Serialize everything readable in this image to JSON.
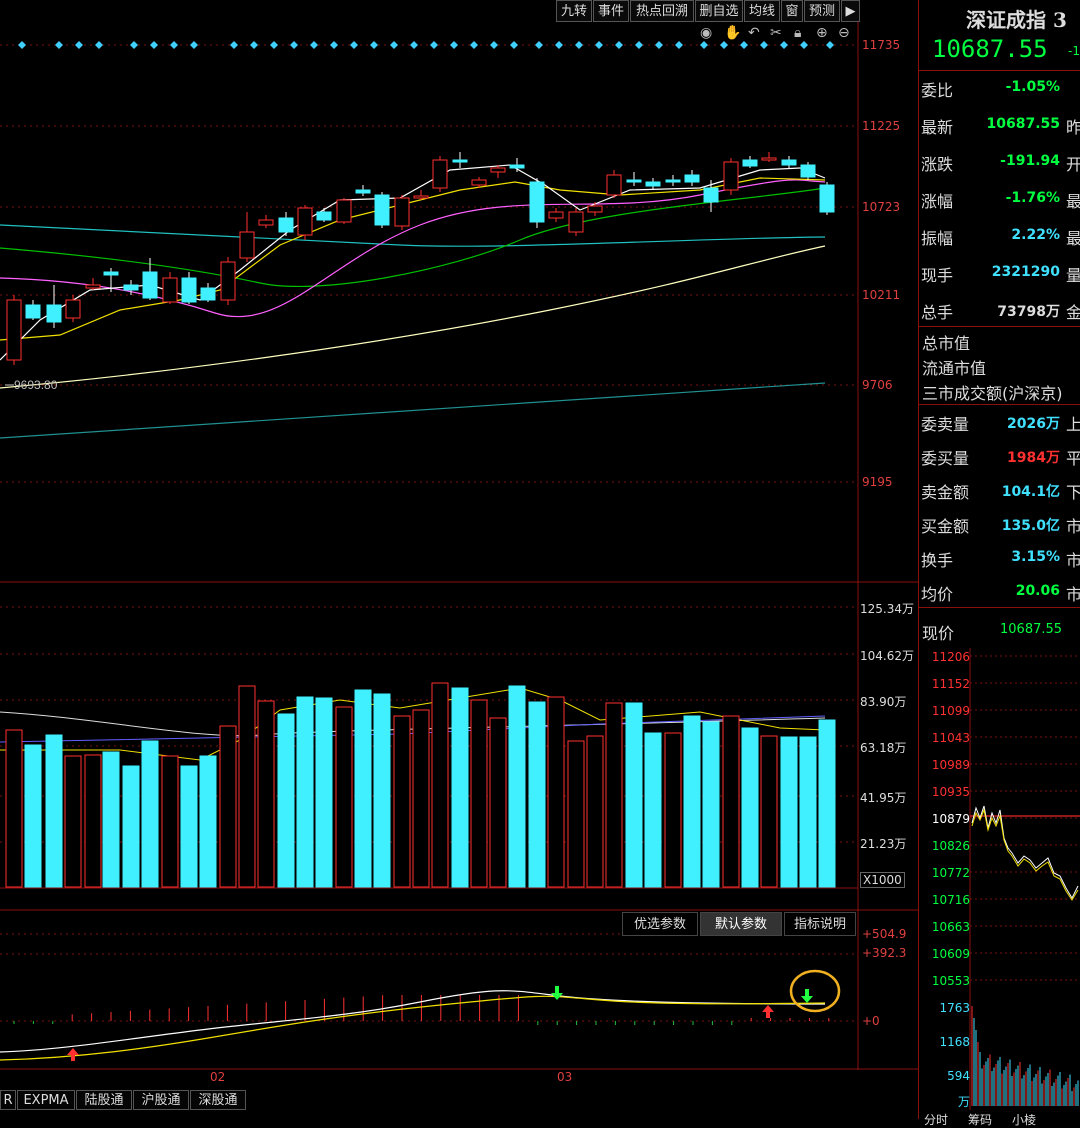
{
  "toolbar": {
    "buttons": [
      "九转",
      "事件",
      "热点回溯",
      "删自选",
      "均线",
      "窗",
      "预测"
    ],
    "icons": [
      "eye-icon",
      "hand-icon",
      "undo-icon",
      "scissors-icon",
      "lock-icon",
      "zoom-in-icon",
      "zoom-out-icon"
    ]
  },
  "main_chart": {
    "price_ticks": [
      "11735",
      "11225",
      "10723",
      "10211",
      "9706",
      "9195"
    ],
    "low_marker": "9693.80"
  },
  "volume_chart": {
    "ticks": [
      "125.34万",
      "104.62万",
      "83.90万",
      "63.18万",
      "41.95万",
      "21.23万"
    ],
    "multiplier": "X1000"
  },
  "indicator_panel": {
    "buttons": [
      "优选参数",
      "默认参数",
      "指标说明"
    ],
    "ticks": [
      "+504.9",
      "+392.3",
      "+0"
    ],
    "x_labels": [
      "02",
      "03"
    ]
  },
  "bottom_tabs": [
    "R",
    "EXPMA",
    "陆股通",
    "沪股通",
    "深股通"
  ],
  "quote": {
    "title": "深证成指 3",
    "price": "10687.55",
    "change_hint": "-1",
    "rows": [
      {
        "key": "委比",
        "value": "-1.05%",
        "color": "#00ff40",
        "suffix": ""
      },
      {
        "key": "最新",
        "value": "10687.55",
        "color": "#00ff40",
        "suffix": "昨"
      },
      {
        "key": "涨跌",
        "value": "-191.94",
        "color": "#00ff40",
        "suffix": "开"
      },
      {
        "key": "涨幅",
        "value": "-1.76%",
        "color": "#00ff40",
        "suffix": "最"
      },
      {
        "key": "振幅",
        "value": "2.22%",
        "color": "#40e0ff",
        "suffix": "最"
      },
      {
        "key": "现手",
        "value": "2321290",
        "color": "#40e0ff",
        "suffix": "量"
      },
      {
        "key": "总手",
        "value": "73798万",
        "color": "#dddddd",
        "suffix": "金"
      }
    ],
    "info_lines": [
      "总市值",
      "流通市值",
      "三市成交额(沪深京)"
    ],
    "rows2": [
      {
        "key": "委卖量",
        "value": "2026万",
        "color": "#40e0ff",
        "suffix": "上"
      },
      {
        "key": "委买量",
        "value": "1984万",
        "color": "#ff3030",
        "suffix": "平"
      },
      {
        "key": "卖金额",
        "value": "104.1亿",
        "color": "#40e0ff",
        "suffix": "下"
      },
      {
        "key": "买金额",
        "value": "135.0亿",
        "color": "#40e0ff",
        "suffix": "市"
      },
      {
        "key": "换手",
        "value": "3.15%",
        "color": "#40e0ff",
        "suffix": "市"
      },
      {
        "key": "均价",
        "value": "20.06",
        "color": "#00ff40",
        "suffix": "市"
      }
    ],
    "current_label": "现价",
    "current_value": "10687.55"
  },
  "mini_chart": {
    "price_ticks": [
      "11206",
      "11152",
      "11099",
      "11043",
      "10989",
      "10935",
      "10879",
      "10826",
      "10772",
      "10716",
      "10663",
      "10609",
      "10553"
    ],
    "vol_ticks": [
      "1763",
      "1168",
      "594",
      "万"
    ],
    "tabs": [
      "分时",
      "筹码",
      "小棱"
    ]
  },
  "colors": {
    "up": "#ff3030",
    "down": "#40f0ff",
    "grid": "#7a1010",
    "ma5": "#ffffff",
    "ma10": "#f0e000",
    "ma20": "#ff60ff",
    "ma30": "#00c000",
    "ma60": "#20c0c0",
    "ma120": "#ffffc0"
  }
}
